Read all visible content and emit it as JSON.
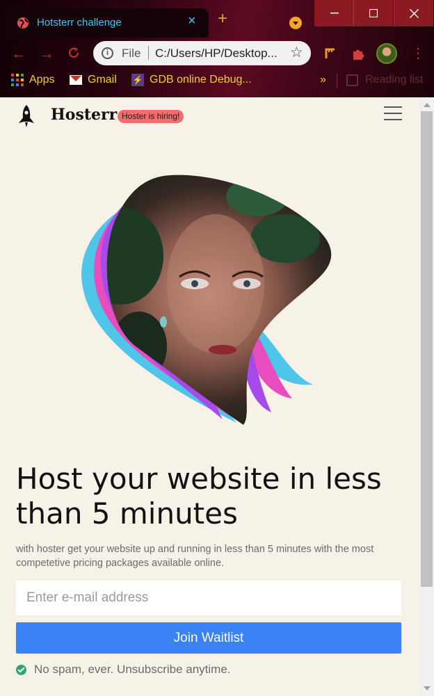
{
  "browser": {
    "tab_title": "Hotsterr challenge",
    "omnibox_scheme": "File",
    "url": "C:/Users/HP/Desktop...",
    "bookmarks": [
      "Apps",
      "Gmail",
      "GDB online Debug..."
    ],
    "reading_list": "Reading list",
    "more_bookmarks": "»"
  },
  "header": {
    "brand": "Hosterr",
    "badge": "Hoster is hiring!"
  },
  "hero": {
    "headline": "Host your website in less than 5 minutes",
    "subtext": "with hoster get your website up and running in less than 5 minutes with the most competetive pricing packages available online.",
    "email_placeholder": "Enter e-mail address",
    "cta_label": "Join Waitlist",
    "note": "No spam, ever. Unsubscribe anytime."
  },
  "colors": {
    "accent": "#3b82f6",
    "badge": "#f26d6d",
    "background": "#f7f2e8",
    "check": "#2fa37a"
  }
}
